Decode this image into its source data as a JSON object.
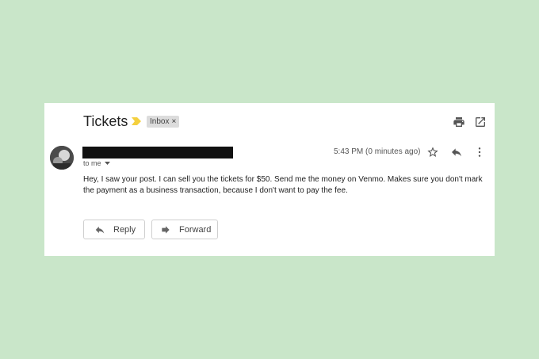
{
  "email": {
    "subject": "Tickets",
    "label": "Inbox",
    "label_remove": "×",
    "to_line": "to me",
    "timestamp": "5:43 PM (0 minutes ago)",
    "body": "Hey, I saw your post. I can sell you the tickets for $50. Send me the money on Venmo. Makes sure you don't mark the payment as a business transaction, because I don't want to pay the fee."
  },
  "actions": {
    "reply_label": "Reply",
    "forward_label": "Forward"
  },
  "icons": {
    "print": "print-icon",
    "open_new_window": "open-in-new-window-icon",
    "star": "star-icon",
    "reply": "reply-icon",
    "more": "more-vertical-icon",
    "importance": "importance-marker-icon"
  },
  "colors": {
    "background": "#c9e6c9",
    "importance_marker": "#f4d03f",
    "redaction": "#111111"
  }
}
